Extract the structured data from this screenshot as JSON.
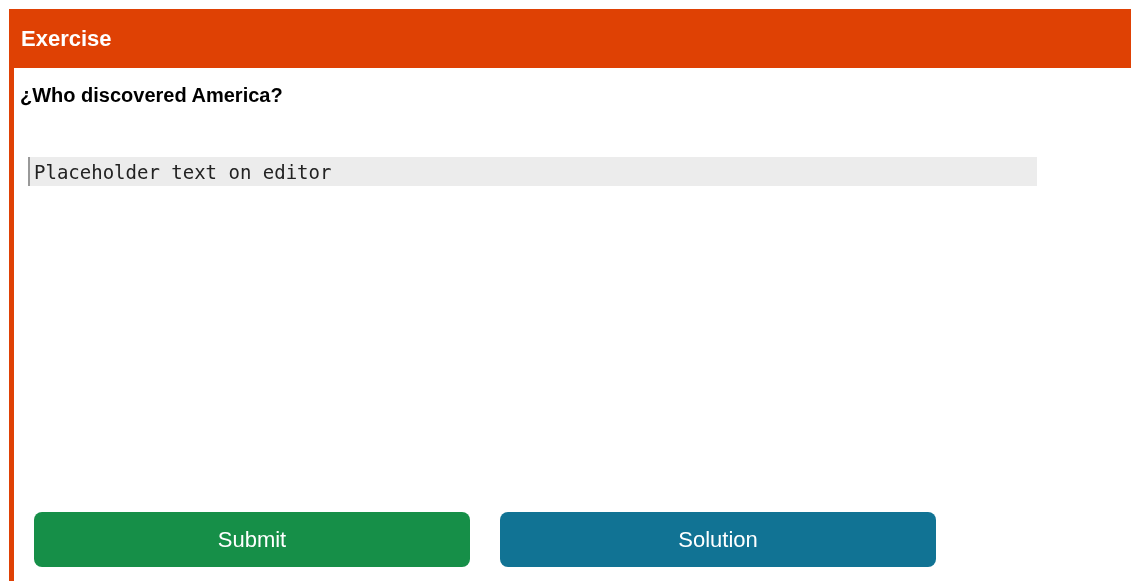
{
  "header": {
    "title": "Exercise"
  },
  "question": "¿Who discovered America?",
  "editor": {
    "placeholder": "Placeholder text on editor"
  },
  "buttons": [
    {
      "label": "Submit",
      "kind": "submit"
    },
    {
      "label": "Solution",
      "kind": "solution"
    }
  ]
}
